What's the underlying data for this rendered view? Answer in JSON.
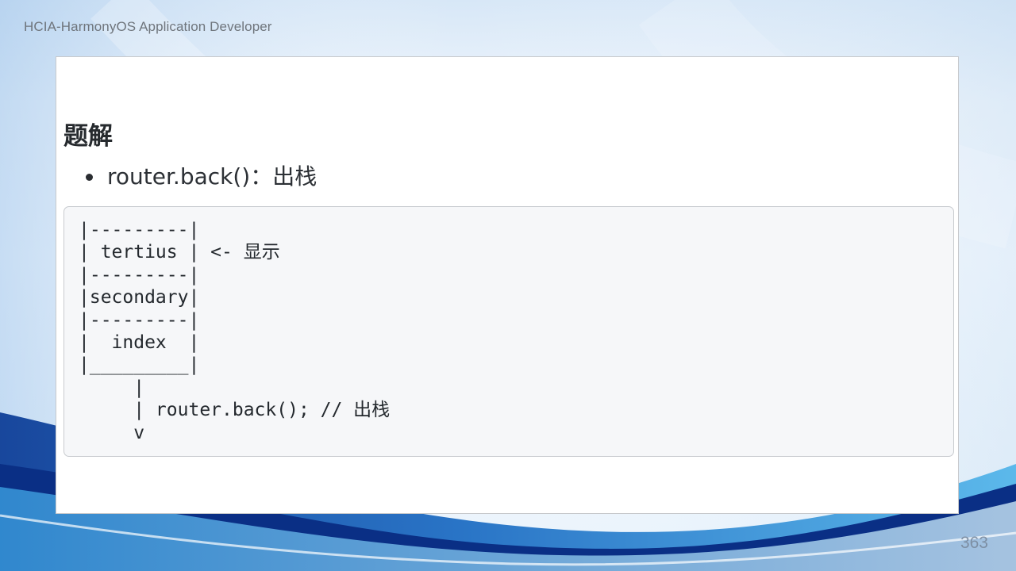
{
  "header": {
    "title": "HCIA-HarmonyOS Application Developer"
  },
  "content": {
    "heading": "题解",
    "bullets": [
      "router.back()：出栈"
    ],
    "code": [
      "|---------|",
      "| tertius | <- 显示",
      "|---------|",
      "|secondary|",
      "|---------|",
      "|  index  |",
      "|_________|",
      "     |",
      "     | router.back(); // 出栈",
      "     v"
    ]
  },
  "footer": {
    "page_number": "363"
  },
  "theme": {
    "accent_dark": "#0b2d78",
    "accent_mid": "#1c78c9",
    "accent_light": "#8fd0f3"
  }
}
